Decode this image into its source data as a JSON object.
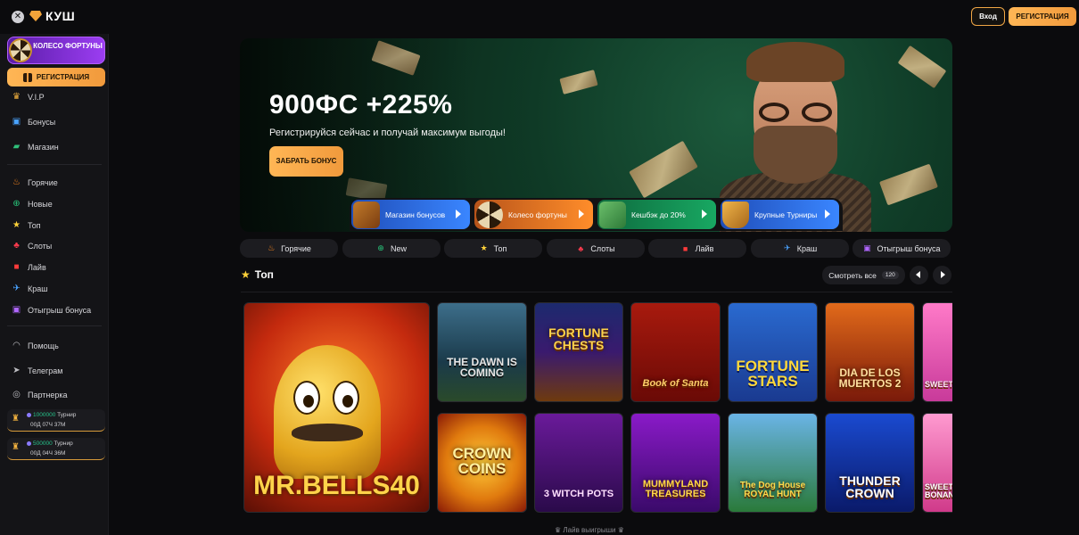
{
  "header": {
    "logo_text": "КУШ",
    "login_label": "Вход",
    "register_label": "РЕГИСТРАЦИЯ"
  },
  "sidebar": {
    "wheel_label": "КОЛЕСО ФОРТУНЫ",
    "register_label": "РЕГИСТРАЦИЯ",
    "items_group1": [
      {
        "label": "V.I.P",
        "icon": "crown-icon"
      },
      {
        "label": "Бонусы",
        "icon": "gift-icon"
      },
      {
        "label": "Магазин",
        "icon": "shop-icon"
      }
    ],
    "items_group2": [
      {
        "label": "Горячие",
        "icon": "fire-icon"
      },
      {
        "label": "Новые",
        "icon": "plus-icon"
      },
      {
        "label": "Топ",
        "icon": "star-icon"
      },
      {
        "label": "Слоты",
        "icon": "cherry-icon"
      },
      {
        "label": "Лайв",
        "icon": "dice-icon"
      },
      {
        "label": "Краш",
        "icon": "plane-icon"
      },
      {
        "label": "Отыгрыш бонуса",
        "icon": "gift-icon"
      }
    ],
    "items_group3": [
      {
        "label": "Помощь",
        "icon": "headset-icon"
      },
      {
        "label": "Телеграм",
        "icon": "telegram-icon"
      },
      {
        "label": "Партнерка",
        "icon": "partner-icon"
      }
    ],
    "tournaments": [
      {
        "amount": "1000000",
        "label": "Турнир",
        "timer": "00Д 07Ч 37М"
      },
      {
        "amount": "500000",
        "label": "Турнир",
        "timer": "00Д 04Ч 36М"
      }
    ]
  },
  "hero": {
    "title": "900ФС +225%",
    "subtitle": "Регистрируйся сейчас и получай максимум выгоды!",
    "cta_label": "ЗАБРАТЬ БОНУС"
  },
  "promos": [
    {
      "label": "Магазин бонусов",
      "color": "#2f6fe0"
    },
    {
      "label": "Колесо фортуны",
      "color": "#e3761f"
    },
    {
      "label": "Кешбэк до 20%",
      "color": "#138a52"
    },
    {
      "label": "Крупные Турниры",
      "color": "#2f6fe0"
    }
  ],
  "categories": [
    {
      "label": "Горячие",
      "icon": "fire-icon"
    },
    {
      "label": "New",
      "icon": "plus-icon"
    },
    {
      "label": "Топ",
      "icon": "star-icon"
    },
    {
      "label": "Слоты",
      "icon": "cherry-icon"
    },
    {
      "label": "Лайв",
      "icon": "dice-icon"
    },
    {
      "label": "Краш",
      "icon": "plane-icon"
    },
    {
      "label": "Отыгрыш бонуса",
      "icon": "gift-icon"
    }
  ],
  "section": {
    "title": "Топ",
    "see_all_label": "Смотреть все",
    "see_all_count": "120"
  },
  "games": [
    {
      "title": "MR.BELLS40"
    },
    {
      "title": "THE DAWN IS COMING"
    },
    {
      "title": "FORTUNE CHESTS"
    },
    {
      "title": "Book of Santa"
    },
    {
      "title": "FORTUNE STARS"
    },
    {
      "title": "DIA DE LOS MUERTOS 2"
    },
    {
      "title": "SWEET"
    },
    {
      "title": "CROWN COINS"
    },
    {
      "title": "3 WITCH POTS"
    },
    {
      "title": "MUMMYLAND TREASURES"
    },
    {
      "title": "The Dog House ROYAL HUNT"
    },
    {
      "title": "THUNDER CROWN"
    },
    {
      "title": "SWEET BONANZA"
    }
  ],
  "footer": {
    "live_label": "Лайв выигрыши"
  }
}
